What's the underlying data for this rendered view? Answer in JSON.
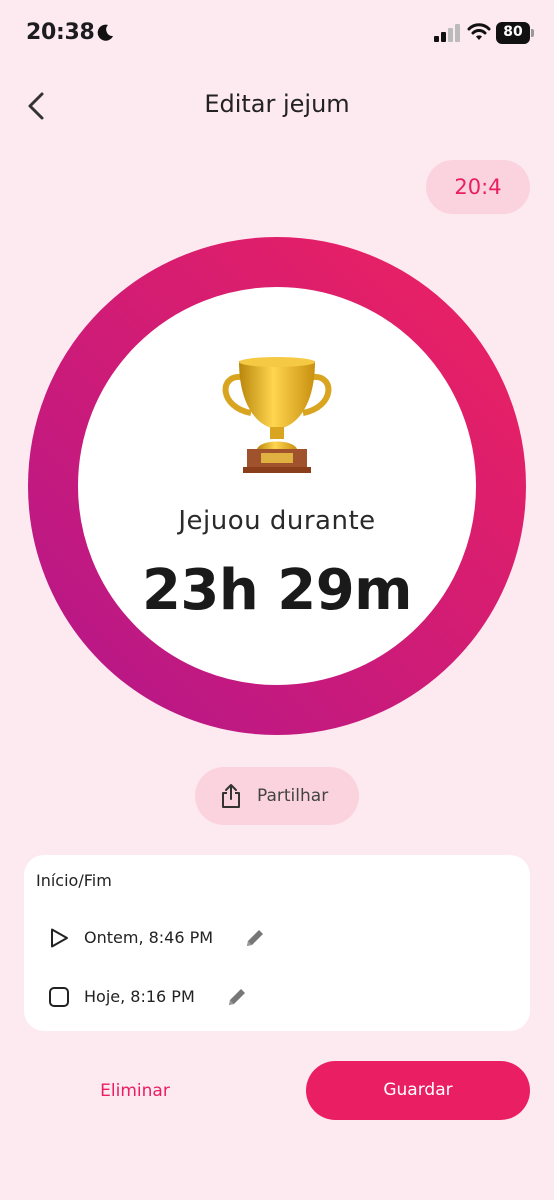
{
  "status_bar": {
    "time": "20:38",
    "battery": "80"
  },
  "header": {
    "title": "Editar jejum"
  },
  "ratio_chip": {
    "label": "20:4"
  },
  "ring": {
    "label": "Jejuou durante",
    "duration": "23h 29m",
    "progress": 1.0,
    "gradient_start": "#b5178a",
    "gradient_end": "#ec2161"
  },
  "share": {
    "label": "Partilhar"
  },
  "times_card": {
    "title": "Início/Fim",
    "start": {
      "text": "Ontem, 8:46 PM"
    },
    "end": {
      "text": "Hoje, 8:16 PM"
    }
  },
  "actions": {
    "delete_label": "Eliminar",
    "save_label": "Guardar"
  },
  "colors": {
    "accent": "#e91e63",
    "background": "#fde9f0",
    "chip": "#fbd3df"
  },
  "icons": [
    "moon-icon",
    "signal-icon",
    "wifi-icon",
    "back-chevron-icon",
    "trophy-icon",
    "share-icon",
    "play-icon",
    "square-icon",
    "pencil-icon"
  ]
}
